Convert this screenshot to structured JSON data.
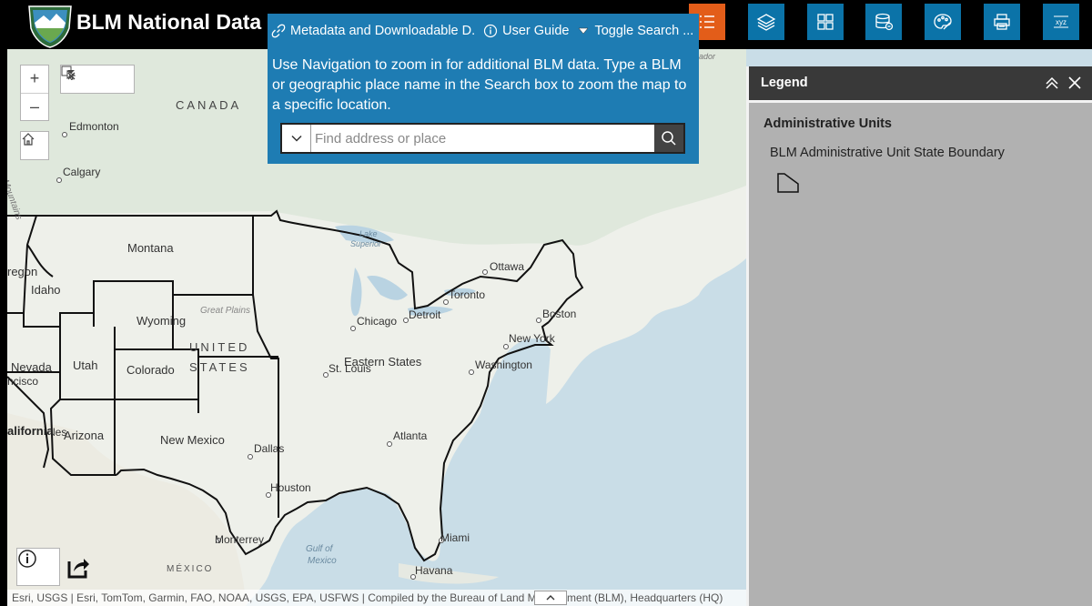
{
  "header": {
    "app_title": "BLM National Data",
    "toolbar": [
      {
        "name": "layer-list",
        "icon": "list-icon",
        "active": true
      },
      {
        "name": "layers",
        "icon": "layers-icon",
        "active": false
      },
      {
        "name": "basemap-gallery",
        "icon": "grid-icon",
        "active": false
      },
      {
        "name": "data",
        "icon": "database-icon",
        "active": false
      },
      {
        "name": "draw",
        "icon": "palette-icon",
        "active": false
      },
      {
        "name": "print",
        "icon": "print-icon",
        "active": false
      },
      {
        "name": "coordinates",
        "icon": "xyz-icon",
        "active": false
      }
    ]
  },
  "search_panel": {
    "links": {
      "metadata": "Metadata and Downloadable D.",
      "user_guide": "User Guide",
      "toggle_search": "Toggle Search ..."
    },
    "message": "Use Navigation to zoom in for additional BLM data. Type a BLM or geographic place name in the Search box to zoom the map to a specific location.",
    "search": {
      "placeholder": "Find address or place",
      "value": ""
    }
  },
  "map_widgets": {
    "zoom_in": "+",
    "zoom_out": "–"
  },
  "legend": {
    "title": "Legend",
    "layer_title": "Administrative Units",
    "item_label": "BLM Administrative Unit State Boundary"
  },
  "map_labels": {
    "canada": "CANADA",
    "united": "UNITED",
    "states": "STATES",
    "mexico": "MÉXICO",
    "gulf1": "Gulf of",
    "gulf2": "Mexico",
    "lake1": "Lake",
    "lake2": "Superior",
    "great_plains": "Great Plains",
    "mountains": "ky Mountains",
    "ador": "ador",
    "edmonton": "Edmonton",
    "calgary": "Calgary",
    "ottawa": "Ottawa",
    "toronto": "Toronto",
    "detroit": "Detroit",
    "chicago": "Chicago",
    "boston": "Boston",
    "new_york": "New York",
    "washington": "Washington",
    "st_louis": "St. Louis",
    "atlanta": "Atlanta",
    "dallas": "Dallas",
    "houston": "Houston",
    "monterrey": "Monterrey",
    "miami": "Miami",
    "havana": "Havana",
    "cisco": "ncisco",
    "angeles": "les",
    "montana": "Montana",
    "oregon": "regon",
    "idaho": "Idaho",
    "wyoming": "Wyoming",
    "nevada": "Nevada",
    "utah": "Utah",
    "colorado": "Colorado",
    "california": "alifornia",
    "arizona": "Arizona",
    "new_mexico": "New Mexico",
    "eastern_states": "Eastern States"
  },
  "attribution": "Esri, USGS | Esri, TomTom, Garmin, FAO, NOAA, USGS, EPA, USFWS | Compiled by the Bureau of Land Management (BLM), Headquarters (HQ)",
  "colors": {
    "header_bg": "#000000",
    "toolbar_blue": "#0b73a8",
    "toolbar_active": "#e35d19",
    "search_panel": "#1e7cb3",
    "legend_bg": "#b1b1b1",
    "legend_header": "#393939"
  }
}
